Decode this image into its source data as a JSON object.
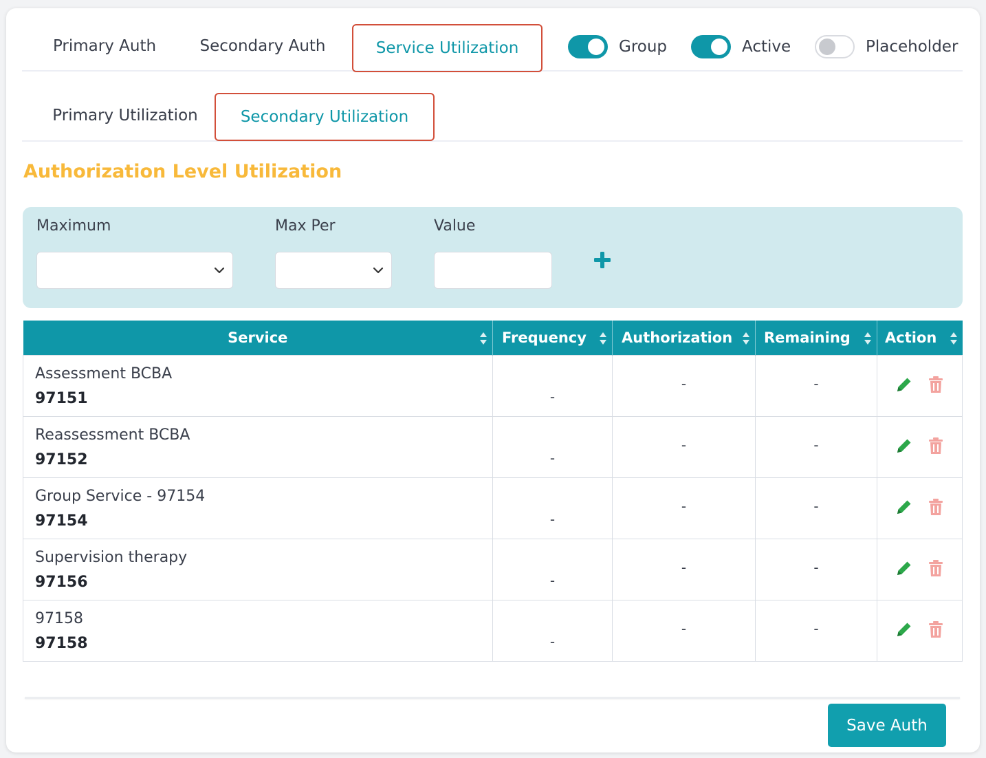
{
  "tabs": {
    "primary_auth": "Primary Auth",
    "secondary_auth": "Secondary Auth",
    "service_utilization": "Service Utilization"
  },
  "toggles": {
    "group": {
      "label": "Group",
      "state": "on"
    },
    "active": {
      "label": "Active",
      "state": "on"
    },
    "placeholder": {
      "label": "Placeholder",
      "state": "off"
    }
  },
  "sub_tabs": {
    "primary_utilization": "Primary Utilization",
    "secondary_utilization": "Secondary Utilization"
  },
  "section_title": "Authorization Level Utilization",
  "filters": {
    "maximum_label": "Maximum",
    "max_per_label": "Max Per",
    "value_label": "Value",
    "add_icon": "plus-icon"
  },
  "table": {
    "headers": {
      "service": "Service",
      "frequency": "Frequency",
      "authorization": "Authorization",
      "remaining": "Remaining",
      "action": "Action"
    },
    "rows": [
      {
        "name": "Assessment BCBA",
        "code": "97151",
        "frequency": "-",
        "authorization": "-",
        "remaining": "-"
      },
      {
        "name": "Reassessment BCBA",
        "code": "97152",
        "frequency": "-",
        "authorization": "-",
        "remaining": "-"
      },
      {
        "name": "Group Service - 97154",
        "code": "97154",
        "frequency": "-",
        "authorization": "-",
        "remaining": "-"
      },
      {
        "name": "Supervision therapy",
        "code": "97156",
        "frequency": "-",
        "authorization": "-",
        "remaining": "-"
      },
      {
        "name": "97158",
        "code": "97158",
        "frequency": "-",
        "authorization": "-",
        "remaining": "-"
      }
    ]
  },
  "save_button": "Save Auth",
  "colors": {
    "accent": "#0f97a8",
    "title": "#f8b93a",
    "highlight_border": "#d24f3a",
    "edit_icon": "#2ca84a",
    "delete_icon": "#f3a39f"
  }
}
